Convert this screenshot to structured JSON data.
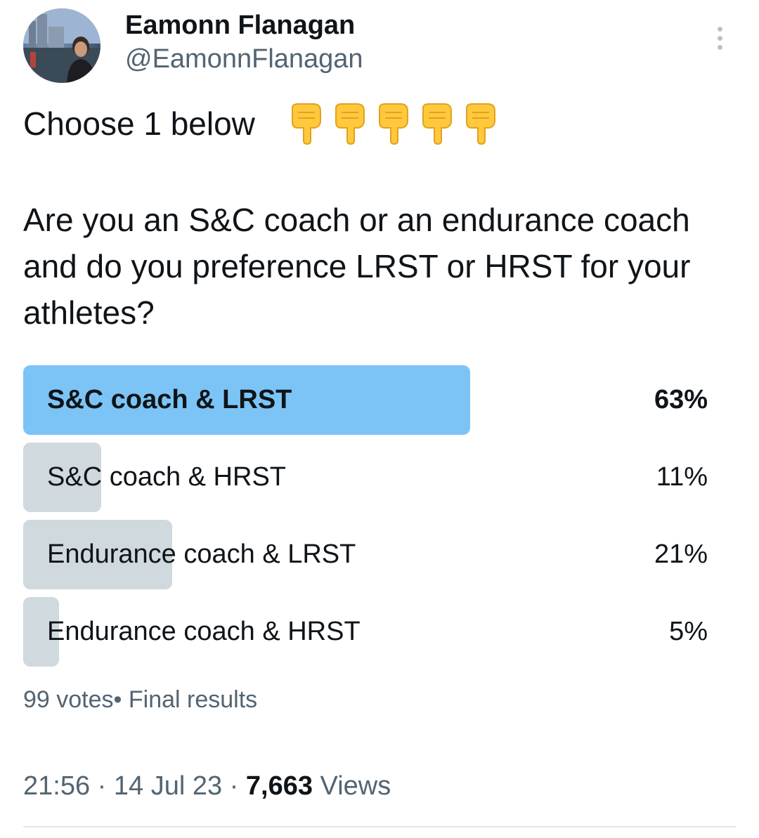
{
  "author": {
    "name": "Eamonn Flanagan",
    "handle": "@EamonnFlanagan"
  },
  "tweet": {
    "line1": "Choose 1 below",
    "emoji": "backhand-index-pointing-down",
    "emoji_count": 5,
    "body": "Are you an S&C coach or an endurance coach and do you preference LRST or HRST for your athletes?"
  },
  "poll": {
    "options": [
      {
        "label": "S&C coach & LRST",
        "percent_text": "63%",
        "fraction": 0.63,
        "winner": true
      },
      {
        "label": "S&C coach & HRST",
        "percent_text": "11%",
        "fraction": 0.11,
        "winner": false
      },
      {
        "label": "Endurance coach & LRST",
        "percent_text": "21%",
        "fraction": 0.21,
        "winner": false
      },
      {
        "label": "Endurance coach & HRST",
        "percent_text": "5%",
        "fraction": 0.05,
        "winner": false
      }
    ],
    "votes": "99 votes",
    "status": "• Final results"
  },
  "meta": {
    "time": "21:56",
    "date": "14 Jul 23",
    "separator": " · ",
    "views_count": "7,663",
    "views_label": "Views"
  },
  "colors": {
    "winner_fill": "#7cc4f5",
    "other_fill": "#cfd9de",
    "secondary_text": "#536471",
    "primary_text": "#0f1419"
  }
}
